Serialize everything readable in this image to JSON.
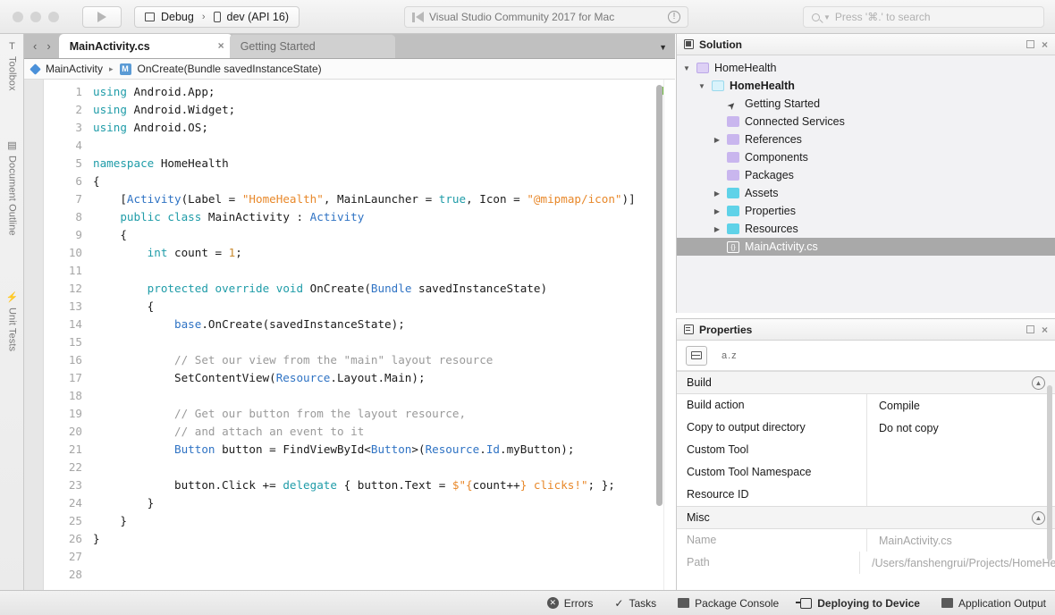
{
  "toolbar": {
    "run_button_label": "Run",
    "config_name": "Debug",
    "device_name": "dev (API 16)",
    "separator": "›",
    "status_text": "Visual Studio Community 2017 for Mac",
    "search_placeholder": "Press '⌘.' to search"
  },
  "left_pads": [
    {
      "label": "Toolbox",
      "icon": "toolbox-icon",
      "glyph": "T"
    },
    {
      "label": "Document Outline",
      "icon": "document-outline-icon",
      "glyph": "▤"
    },
    {
      "label": "Unit Tests",
      "icon": "unit-tests-icon",
      "glyph": "⚡"
    }
  ],
  "tabs": [
    {
      "label": "MainActivity.cs",
      "active": true,
      "close": "×"
    },
    {
      "label": "Getting Started",
      "active": false
    }
  ],
  "tab_overflow_glyph": "▼",
  "nav": {
    "back": "‹",
    "forward": "›"
  },
  "breadcrumb": {
    "class_name": "MainActivity",
    "separator": "▸",
    "method_icon_letter": "M",
    "method_name": "OnCreate(Bundle savedInstanceState)"
  },
  "editor": {
    "lines": [
      {
        "n": "1",
        "tokens": [
          [
            "k",
            "using "
          ],
          [
            "p",
            "Android.App;"
          ]
        ]
      },
      {
        "n": "2",
        "tokens": [
          [
            "k",
            "using "
          ],
          [
            "p",
            "Android.Widget;"
          ]
        ]
      },
      {
        "n": "3",
        "tokens": [
          [
            "k",
            "using "
          ],
          [
            "p",
            "Android.OS;"
          ]
        ]
      },
      {
        "n": "4",
        "tokens": []
      },
      {
        "n": "5",
        "tokens": [
          [
            "k",
            "namespace "
          ],
          [
            "p",
            "HomeHealth"
          ]
        ]
      },
      {
        "n": "6",
        "tokens": [
          [
            "p",
            "{"
          ]
        ]
      },
      {
        "n": "7",
        "tokens": [
          [
            "p",
            "    ["
          ],
          [
            "kb",
            "Activity"
          ],
          [
            "p",
            "(Label = "
          ],
          [
            "s",
            "\"HomeHealth\""
          ],
          [
            "p",
            ", MainLauncher = "
          ],
          [
            "k",
            "true"
          ],
          [
            "p",
            ", Icon = "
          ],
          [
            "s",
            "\"@mipmap/icon\""
          ],
          [
            "p",
            ")]"
          ]
        ]
      },
      {
        "n": "8",
        "tokens": [
          [
            "p",
            "    "
          ],
          [
            "k",
            "public class "
          ],
          [
            "p",
            "MainActivity : "
          ],
          [
            "kb",
            "Activity"
          ]
        ]
      },
      {
        "n": "9",
        "tokens": [
          [
            "p",
            "    {"
          ]
        ]
      },
      {
        "n": "10",
        "tokens": [
          [
            "p",
            "        "
          ],
          [
            "k",
            "int"
          ],
          [
            "p",
            " count = "
          ],
          [
            "n",
            "1"
          ],
          [
            "p",
            ";"
          ]
        ]
      },
      {
        "n": "11",
        "tokens": []
      },
      {
        "n": "12",
        "tokens": [
          [
            "p",
            "        "
          ],
          [
            "k",
            "protected override void "
          ],
          [
            "p",
            "OnCreate("
          ],
          [
            "kb",
            "Bundle"
          ],
          [
            "p",
            " savedInstanceState)"
          ]
        ]
      },
      {
        "n": "13",
        "tokens": [
          [
            "p",
            "        {"
          ]
        ]
      },
      {
        "n": "14",
        "tokens": [
          [
            "p",
            "            "
          ],
          [
            "kb",
            "base"
          ],
          [
            "p",
            ".OnCreate(savedInstanceState);"
          ]
        ]
      },
      {
        "n": "15",
        "tokens": []
      },
      {
        "n": "16",
        "tokens": [
          [
            "p",
            "            "
          ],
          [
            "c",
            "// Set our view from the \"main\" layout resource"
          ]
        ]
      },
      {
        "n": "17",
        "tokens": [
          [
            "p",
            "            SetContentView("
          ],
          [
            "kb",
            "Resource"
          ],
          [
            "p",
            ".Layout.Main);"
          ]
        ]
      },
      {
        "n": "18",
        "tokens": []
      },
      {
        "n": "19",
        "tokens": [
          [
            "p",
            "            "
          ],
          [
            "c",
            "// Get our button from the layout resource,"
          ]
        ]
      },
      {
        "n": "20",
        "tokens": [
          [
            "p",
            "            "
          ],
          [
            "c",
            "// and attach an event to it"
          ]
        ]
      },
      {
        "n": "21",
        "tokens": [
          [
            "p",
            "            "
          ],
          [
            "kb",
            "Button"
          ],
          [
            "p",
            " button = FindViewById<"
          ],
          [
            "kb",
            "Button"
          ],
          [
            "p",
            ">("
          ],
          [
            "kb",
            "Resource"
          ],
          [
            "p",
            "."
          ],
          [
            "kb",
            "Id"
          ],
          [
            "p",
            ".myButton);"
          ]
        ]
      },
      {
        "n": "22",
        "tokens": []
      },
      {
        "n": "23",
        "tokens": [
          [
            "p",
            "            button.Click += "
          ],
          [
            "k",
            "delegate"
          ],
          [
            "p",
            " { button.Text = "
          ],
          [
            "s",
            "$\"{"
          ],
          [
            "p",
            "count++"
          ],
          [
            "s",
            "} clicks!\""
          ],
          [
            "p",
            "; };"
          ]
        ]
      },
      {
        "n": "24",
        "tokens": [
          [
            "p",
            "        }"
          ]
        ]
      },
      {
        "n": "25",
        "tokens": [
          [
            "p",
            "    }"
          ]
        ]
      },
      {
        "n": "26",
        "tokens": [
          [
            "p",
            "}"
          ]
        ]
      },
      {
        "n": "27",
        "tokens": []
      },
      {
        "n": "28",
        "tokens": []
      }
    ]
  },
  "solution": {
    "title": "Solution",
    "restore_glyph": "□",
    "close_glyph": "×",
    "nodes": [
      {
        "label": "HomeHealth",
        "indent": 0,
        "twist": "open",
        "icon": "solution-icon",
        "bold": false,
        "selected": false
      },
      {
        "label": "HomeHealth",
        "indent": 1,
        "twist": "open",
        "icon": "project-icon",
        "bold": true,
        "selected": false
      },
      {
        "label": "Getting Started",
        "indent": 2,
        "twist": "none",
        "icon": "rocket-icon",
        "bold": false,
        "selected": false
      },
      {
        "label": "Connected Services",
        "indent": 2,
        "twist": "none",
        "icon": "connected-services-icon",
        "bold": false,
        "selected": false
      },
      {
        "label": "References",
        "indent": 2,
        "twist": "closed",
        "icon": "references-folder-icon",
        "bold": false,
        "selected": false
      },
      {
        "label": "Components",
        "indent": 2,
        "twist": "none",
        "icon": "components-folder-icon",
        "bold": false,
        "selected": false
      },
      {
        "label": "Packages",
        "indent": 2,
        "twist": "none",
        "icon": "packages-folder-icon",
        "bold": false,
        "selected": false
      },
      {
        "label": "Assets",
        "indent": 2,
        "twist": "closed",
        "icon": "assets-folder-icon",
        "bold": false,
        "selected": false
      },
      {
        "label": "Properties",
        "indent": 2,
        "twist": "closed",
        "icon": "properties-folder-icon",
        "bold": false,
        "selected": false
      },
      {
        "label": "Resources",
        "indent": 2,
        "twist": "closed",
        "icon": "resources-folder-icon",
        "bold": false,
        "selected": false
      },
      {
        "label": "MainActivity.cs",
        "indent": 2,
        "twist": "none",
        "icon": "csharp-file-icon",
        "bold": false,
        "selected": true
      }
    ]
  },
  "properties": {
    "title": "Properties",
    "restore_glyph": "□",
    "close_glyph": "×",
    "sort_label": "a.z",
    "collapse_glyph": "▲",
    "groups": [
      {
        "name": "Build",
        "rows": [
          {
            "name": "Build action",
            "value": "Compile",
            "dim": false
          },
          {
            "name": "Copy to output directory",
            "value": "Do not copy",
            "dim": false
          },
          {
            "name": "Custom Tool",
            "value": "",
            "dim": false
          },
          {
            "name": "Custom Tool Namespace",
            "value": "",
            "dim": false
          },
          {
            "name": "Resource ID",
            "value": "",
            "dim": false
          }
        ]
      },
      {
        "name": "Misc",
        "rows": [
          {
            "name": "Name",
            "value": "MainActivity.cs",
            "dim": true
          },
          {
            "name": "Path",
            "value": "/Users/fanshengrui/Projects/HomeHea",
            "dim": true
          }
        ]
      }
    ]
  },
  "statusbar": {
    "items": [
      {
        "label": "Errors",
        "icon": "errors-icon",
        "strong": false
      },
      {
        "label": "Tasks",
        "icon": "tasks-check-icon",
        "strong": false
      },
      {
        "label": "Package Console",
        "icon": "package-console-icon",
        "strong": false
      },
      {
        "label": "Deploying to Device",
        "icon": "deploy-device-icon",
        "strong": true
      },
      {
        "label": "Application Output",
        "icon": "application-output-icon",
        "strong": false
      }
    ]
  },
  "colors": {
    "accent_blue": "#4a90d9",
    "keyword_teal": "#1f9ca8",
    "string_orange": "#e8882a",
    "comment_gray": "#9a9a9a",
    "type_blue": "#2f73c4",
    "status_ok_green": "#74c043",
    "selection_gray": "#a9a9a9"
  }
}
